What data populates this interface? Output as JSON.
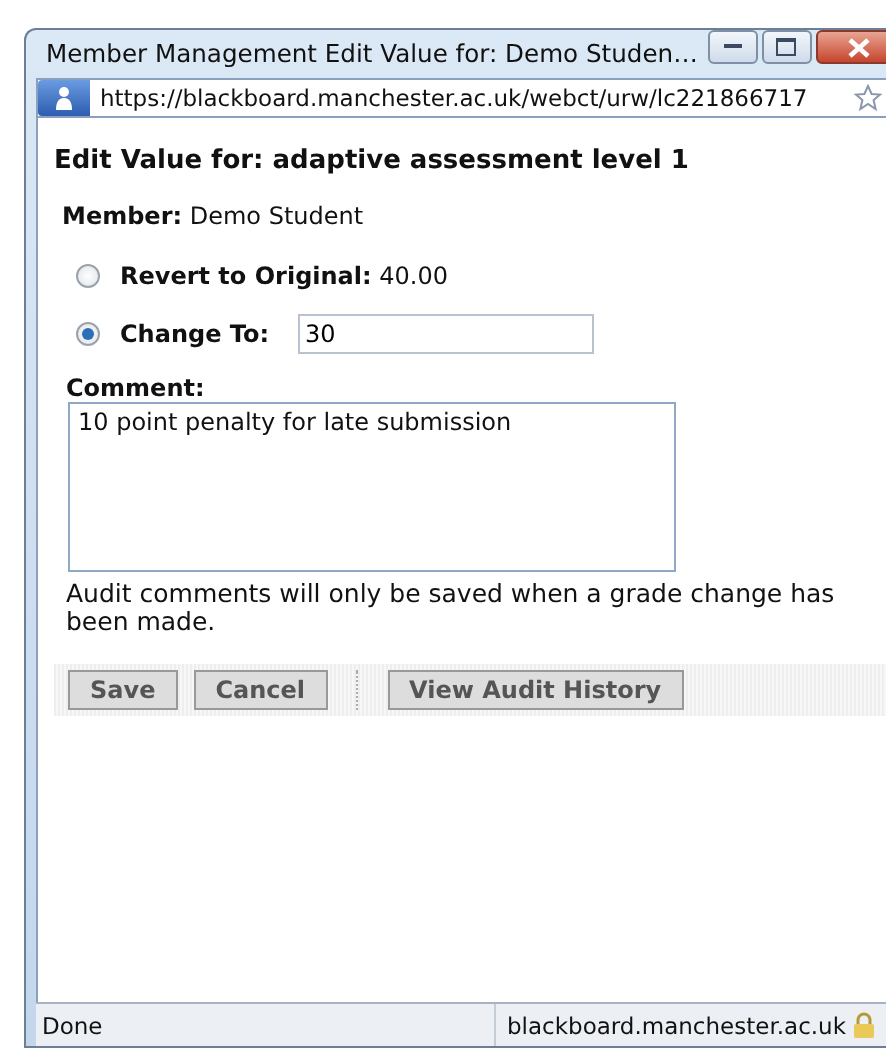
{
  "window": {
    "title": "Member Management Edit Value for: Demo Studen…",
    "url": "https://blackboard.manchester.ac.uk/webct/urw/lc221866717"
  },
  "form": {
    "heading": "Edit Value for: adaptive assessment level 1",
    "member": {
      "label": "Member:",
      "value": "Demo Student"
    },
    "options": [
      {
        "kind": "text",
        "label": "Revert to Original:",
        "value": "40.00",
        "selected": false
      },
      {
        "kind": "input",
        "label": "Change To:",
        "value": "30",
        "selected": true
      }
    ],
    "comment": {
      "label": "Comment:",
      "value": "10 point penalty for late submission"
    },
    "note": "Audit comments will only be saved when a grade change has been made.",
    "buttons": [
      "Save",
      "Cancel"
    ],
    "history_button": "View Audit History"
  },
  "status_bar": {
    "status": "Done",
    "domain": "blackboard.manchester.ac.uk"
  }
}
